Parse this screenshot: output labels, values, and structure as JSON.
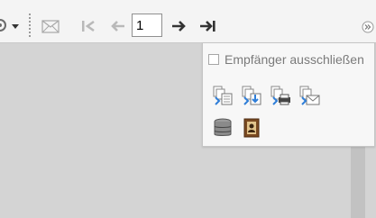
{
  "toolbar": {
    "page_number": "1",
    "icons": [
      "gear-icon",
      "dropdown-arrow-icon",
      "envelope-icon",
      "first-page-icon",
      "previous-page-icon",
      "next-page-icon",
      "last-page-icon",
      "overflow-icon"
    ]
  },
  "dropdown": {
    "exclude_recipients_label": "Empfänger ausschließen",
    "exclude_recipients_checked": false,
    "actions": [
      "merge-to-document-icon",
      "merge-to-file-icon",
      "merge-to-printer-icon",
      "merge-to-email-icon",
      "database-icon",
      "address-book-icon"
    ]
  },
  "colors": {
    "toolbar_bg": "#f4f4f4",
    "canvas_bg": "#d4d4d4",
    "menu_bg": "#f7f7f7",
    "accent_blue": "#2f7ed8"
  }
}
